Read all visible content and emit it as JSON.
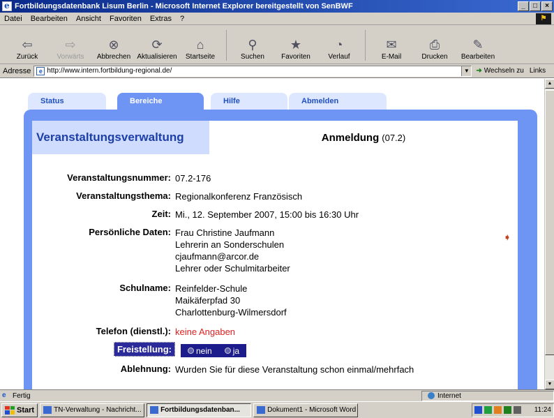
{
  "window": {
    "title": "Fortbildungsdatenbank Lisum Berlin - Microsoft Internet Explorer bereitgestellt von SenBWF",
    "controls": [
      "_",
      "□",
      "×"
    ]
  },
  "menu": [
    "Datei",
    "Bearbeiten",
    "Ansicht",
    "Favoriten",
    "Extras",
    "?"
  ],
  "toolbar": [
    {
      "label": "Zurück",
      "icon": "back-arrow-icon",
      "glyph": "⇦",
      "disabled": false
    },
    {
      "label": "Vorwärts",
      "icon": "forward-arrow-icon",
      "glyph": "⇨",
      "disabled": true
    },
    {
      "label": "Abbrechen",
      "icon": "stop-icon",
      "glyph": "⊗",
      "disabled": false
    },
    {
      "label": "Aktualisieren",
      "icon": "refresh-icon",
      "glyph": "⟳",
      "disabled": false
    },
    {
      "label": "Startseite",
      "icon": "home-icon",
      "glyph": "⌂",
      "disabled": false
    },
    {
      "label": "Suchen",
      "icon": "search-icon",
      "glyph": "⚲",
      "disabled": false
    },
    {
      "label": "Favoriten",
      "icon": "favorites-icon",
      "glyph": "★",
      "disabled": false
    },
    {
      "label": "Verlauf",
      "icon": "history-icon",
      "glyph": "◔",
      "disabled": false
    },
    {
      "label": "E-Mail",
      "icon": "mail-icon",
      "glyph": "✉",
      "disabled": false
    },
    {
      "label": "Drucken",
      "icon": "print-icon",
      "glyph": "⎙",
      "disabled": false
    },
    {
      "label": "Bearbeiten",
      "icon": "edit-icon",
      "glyph": "✎",
      "disabled": false
    }
  ],
  "address": {
    "label": "Adresse",
    "url": "http://www.intern.fortbildung-regional.de/",
    "go_label": "Wechseln zu",
    "links_label": "Links"
  },
  "site": {
    "tabs": [
      {
        "label": "Status",
        "active": false
      },
      {
        "label": "Bereiche",
        "active": true
      },
      {
        "label": "Hilfe",
        "active": false
      },
      {
        "label": "Abmelden",
        "active": false
      }
    ],
    "section_title": "Veranstaltungsverwaltung",
    "page_title": "Anmeldung",
    "page_code": "(07.2)"
  },
  "form": {
    "veranstaltungsnummer": {
      "label": "Veranstaltungsnummer:",
      "value": "07.2-176"
    },
    "veranstaltungsthema": {
      "label": "Veranstaltungsthema:",
      "value": "Regionalkonferenz Französisch"
    },
    "zeit": {
      "label": "Zeit:",
      "value": "Mi., 12. September 2007, 15:00 bis 16:30 Uhr"
    },
    "persoenliche_daten": {
      "label": "Persönliche Daten:",
      "lines": [
        "Frau Christine Jaufmann",
        "Lehrerin an Sonderschulen",
        "cjaufmann@arcor.de",
        "Lehrer oder Schulmitarbeiter"
      ]
    },
    "schulname": {
      "label": "Schulname:",
      "lines": [
        "Reinfelder-Schule",
        "Maikäferpfad 30",
        "Charlottenburg-Wilmersdorf"
      ]
    },
    "telefon": {
      "label": "Telefon (dienstl.):",
      "value": "keine Angaben"
    },
    "freistellung": {
      "label": "Freistellung:",
      "options": [
        "nein",
        "ja"
      ]
    },
    "ablehnung": {
      "label": "Ablehnung:",
      "value": "Wurden Sie für diese Veranstaltung schon einmal/mehrfach"
    }
  },
  "statusbar": {
    "text": "Fertig",
    "zone": "Internet"
  },
  "taskbar": {
    "start": "Start",
    "tasks": [
      {
        "label": "TN-Verwaltung - Nachricht...",
        "active": false
      },
      {
        "label": "Fortbildungsdatenban...",
        "active": true
      },
      {
        "label": "Dokument1 - Microsoft Word",
        "active": false
      }
    ],
    "clock": "11:24"
  },
  "colors": {
    "panel_blue": "#6e94f4",
    "panel_head_bg": "#cfdcfd",
    "title_blue": "#1c3fa8",
    "warning_red": "#e02020",
    "highlight_navy": "#1c1c8c"
  }
}
